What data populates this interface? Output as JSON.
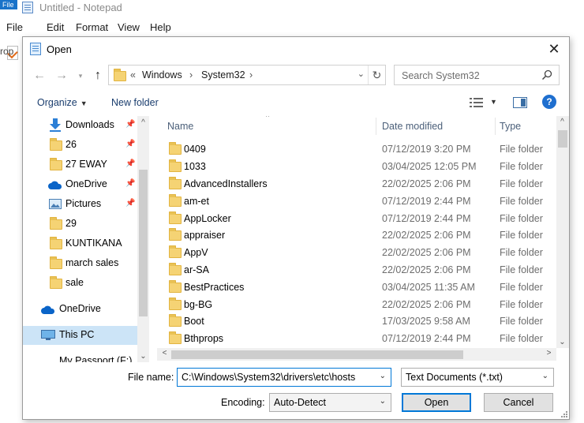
{
  "notepad": {
    "title": "Untitled - Notepad",
    "file_tab": "File",
    "menu": [
      "File",
      "Edit",
      "Format",
      "View",
      "Help"
    ],
    "fragment_left": "rop"
  },
  "dialog": {
    "title": "Open",
    "address": {
      "prefix": "«",
      "crumbs": [
        "Windows",
        "System32"
      ]
    },
    "search": {
      "placeholder": "Search System32"
    },
    "toolbar": {
      "organize": "Organize",
      "new_folder": "New folder"
    },
    "nav": [
      {
        "label": "Downloads",
        "icon": "download-icon",
        "pinned": true
      },
      {
        "label": "26",
        "icon": "folder-icon",
        "pinned": true
      },
      {
        "label": "27 EWAY",
        "icon": "folder-icon",
        "pinned": true
      },
      {
        "label": "OneDrive",
        "icon": "onedrive-icon",
        "pinned": true
      },
      {
        "label": "Pictures",
        "icon": "pictures-icon",
        "pinned": true
      },
      {
        "label": "29",
        "icon": "folder-icon",
        "pinned": false
      },
      {
        "label": "KUNTIKANA",
        "icon": "folder-icon",
        "pinned": false
      },
      {
        "label": "march sales",
        "icon": "folder-icon",
        "pinned": false
      },
      {
        "label": "sale",
        "icon": "folder-icon",
        "pinned": false
      },
      {
        "label": "OneDrive",
        "icon": "onedrive-icon",
        "pinned": false
      },
      {
        "label": "This PC",
        "icon": "computer-icon",
        "pinned": false,
        "selected": true
      },
      {
        "label": "My Passport (F:)",
        "icon": "drive-icon",
        "pinned": false
      }
    ],
    "columns": {
      "name": "Name",
      "date": "Date modified",
      "type": "Type"
    },
    "files": [
      {
        "name": "0409",
        "date": "07/12/2019 3:20 PM",
        "type": "File folder"
      },
      {
        "name": "1033",
        "date": "03/04/2025 12:05 PM",
        "type": "File folder"
      },
      {
        "name": "AdvancedInstallers",
        "date": "22/02/2025 2:06 PM",
        "type": "File folder"
      },
      {
        "name": "am-et",
        "date": "07/12/2019 2:44 PM",
        "type": "File folder"
      },
      {
        "name": "AppLocker",
        "date": "07/12/2019 2:44 PM",
        "type": "File folder"
      },
      {
        "name": "appraiser",
        "date": "22/02/2025 2:06 PM",
        "type": "File folder"
      },
      {
        "name": "AppV",
        "date": "22/02/2025 2:06 PM",
        "type": "File folder"
      },
      {
        "name": "ar-SA",
        "date": "22/02/2025 2:06 PM",
        "type": "File folder"
      },
      {
        "name": "BestPractices",
        "date": "03/04/2025 11:35 AM",
        "type": "File folder"
      },
      {
        "name": "bg-BG",
        "date": "22/02/2025 2:06 PM",
        "type": "File folder"
      },
      {
        "name": "Boot",
        "date": "17/03/2025 9:58 AM",
        "type": "File folder"
      },
      {
        "name": "Bthprops",
        "date": "07/12/2019 2:44 PM",
        "type": "File folder"
      }
    ],
    "file_name": {
      "label": "File name:",
      "value": "C:\\Windows\\System32\\drivers\\etc\\hosts"
    },
    "filter": "Text Documents (*.txt)",
    "encoding": {
      "label": "Encoding:",
      "value": "Auto-Detect"
    },
    "buttons": {
      "open": "Open",
      "cancel": "Cancel"
    },
    "colors": {
      "accent": "#0078d7",
      "folder": "#f5d374",
      "selected": "#cce4f7"
    }
  }
}
